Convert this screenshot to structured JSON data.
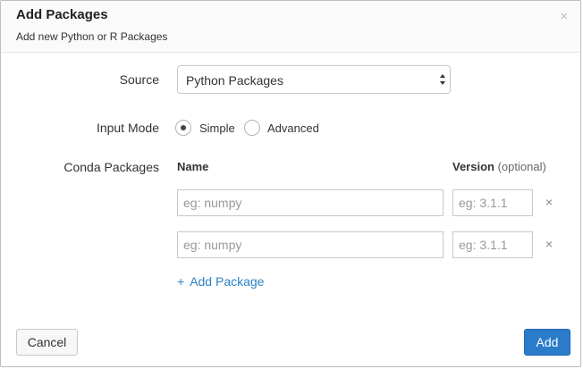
{
  "dialog": {
    "title": "Add Packages",
    "subtitle": "Add new Python or R Packages",
    "close_glyph": "×"
  },
  "source": {
    "label": "Source",
    "selected": "Python Packages"
  },
  "input_mode": {
    "label": "Input Mode",
    "options": [
      {
        "label": "Simple",
        "selected": true
      },
      {
        "label": "Advanced",
        "selected": false
      }
    ]
  },
  "packages": {
    "label": "Conda Packages",
    "name_header": "Name",
    "version_header": "Version",
    "version_optional": "(optional)",
    "rows": [
      {
        "name_placeholder": "eg: numpy",
        "version_placeholder": "eg: 3.1.1",
        "remove_glyph": "×"
      },
      {
        "name_placeholder": "eg: numpy",
        "version_placeholder": "eg: 3.1.1",
        "remove_glyph": "×"
      }
    ],
    "add_package_label": "Add Package",
    "add_package_glyph": "+"
  },
  "footer": {
    "cancel_label": "Cancel",
    "add_label": "Add"
  },
  "colors": {
    "accent": "#2a7ccb",
    "link": "#2d82c5"
  }
}
